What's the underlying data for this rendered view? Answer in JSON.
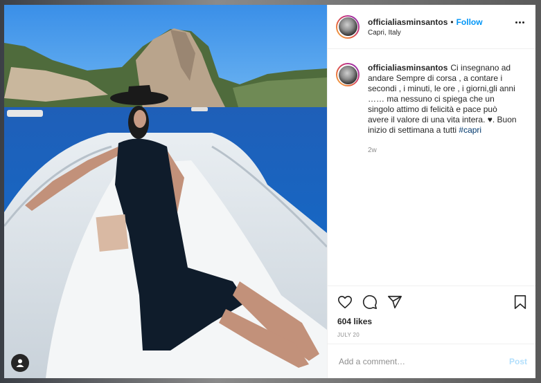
{
  "post": {
    "username": "officialiasminsantos",
    "follow_label": "Follow",
    "separator": "•",
    "location": "Capri, Italy",
    "more_icon": "more-options-icon"
  },
  "caption": {
    "username": "officialiasminsantos",
    "text": "Ci insegnano ad andare Sempre di corsa , a contare i secondi , i minuti, le ore , i giorni,gli anni …… ma nessuno ci spiega che un singolo attimo di felicità e pace può avere il valore di una vita intera. ♥. Buon inizio di settimana a tutti ",
    "hashtag": "#capri",
    "age": "2w"
  },
  "actions": {
    "icons": [
      "heart-icon",
      "comment-icon",
      "share-icon",
      "bookmark-icon"
    ],
    "likes": "604 likes",
    "date": "JULY 20"
  },
  "comment_box": {
    "placeholder": "Add a comment…",
    "post_label": "Post"
  },
  "colors": {
    "accent": "#0095f6",
    "post_disabled": "#b2dffc",
    "hashtag": "#00376b"
  }
}
